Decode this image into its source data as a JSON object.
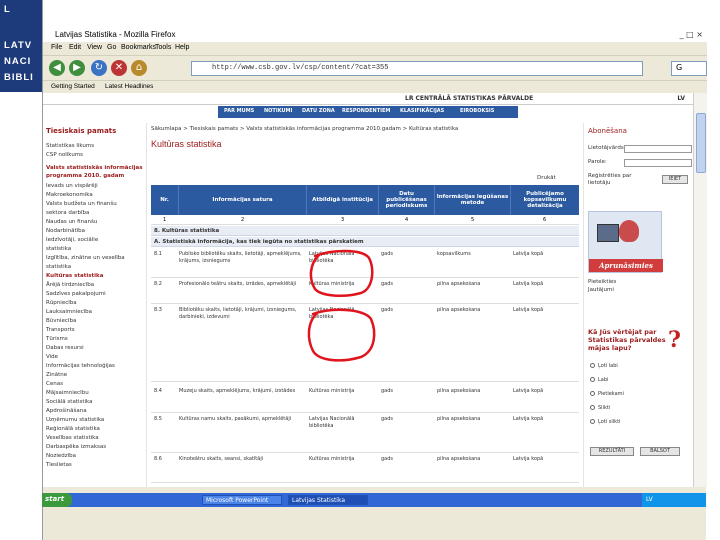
{
  "library_logo": [
    "L",
    "LATV",
    "NACI",
    "BIBLI"
  ],
  "window": {
    "title": "Latvijas Statistika - Mozilla Firefox",
    "controls": "_ □ ×"
  },
  "menu": [
    "File",
    "Edit",
    "View",
    "Go",
    "Bookmarks",
    "Tools",
    "Help"
  ],
  "address": {
    "url": "http://www.csb.gov.lv/csp/content/?cat=355",
    "search_value": "G"
  },
  "bookmarks": [
    "Getting Started",
    "Latest Headlines"
  ],
  "site": {
    "name": "LR CENTRĀLĀ STATISTIKAS PĀRVALDE",
    "lang": "LV",
    "nav": [
      "PAR MUMS",
      "NOTIKUMI",
      "DATU ZONA",
      "RESPONDENTIEM",
      "KLASIFIKĀCIJAS",
      "EIROBOKSIS"
    ]
  },
  "left": {
    "section": "Tiesiskais pamats",
    "links": [
      "Statistikas likums",
      "CSP nolikums"
    ],
    "highlight": [
      "Valsts statistiskās informācijas",
      "programma 2010. gadam"
    ],
    "items": [
      "Ievads un vispārēji",
      "Makroekonomika",
      "Valsts budžeta un finanšu",
      "sektora darbība",
      "Naudas un finanšu",
      "Nodarbinātība",
      "Iedzīvotāji, sociālie",
      "statistika",
      "Izglītība, zinātne un veselība",
      "statistika",
      "Kultūras statistika",
      "Ārējā tirdzniecība",
      "Sadzīves pakalpojumi",
      "Rūpniecība",
      "Lauksaimniecība",
      "Būvniecība",
      "Transports",
      "Tūrisms",
      "Dabas resursi",
      "Vide",
      "Informācijas tehnoloģijas",
      "Zinātne",
      "Cenas",
      "Mājsaimniecību",
      "Sociālā statistika",
      "Apdrošināšana",
      "Uzņēmumu statistika",
      "Reģionālā statistika",
      "Veselības statistika",
      "Darbaspēka izmaksas",
      "Noziedzība",
      "Tieslietas"
    ]
  },
  "main": {
    "breadcrumb": "Sākumlapa > Tiesiskais pamats > Valsts statistiskās informācijas programma 2010.gadam > Kultūras statistika",
    "title": "Kultūras statistika",
    "print": "Drukāt",
    "headers": [
      "Nr.",
      "Informācijas satura",
      "Atbildīgā institūcija",
      "Datu publicēšanas periodiskums",
      "Informācijas iegūšanas metode",
      "Publicējamo kopsavilkumu detalizācija"
    ],
    "col_numbers": [
      "1",
      "2",
      "3",
      "4",
      "5",
      "6"
    ],
    "section_a": "8. Kultūras statistika",
    "section_b": "A. Statistiskā informācija, kas tiek iegūta no statistikas pārskatiem",
    "rows_a": [
      {
        "nr": "8.1",
        "content": "Publisko bibliotēku skaits, lietotāji, apmeklējums, krājums, izsniegums",
        "inst": "Latvijas Nacionālā bibliotēka",
        "period": "gads",
        "method": "kopsavilkums",
        "detail": "Latvija kopā"
      },
      {
        "nr": "8.2",
        "content": "Profesionālo teātru skaits, izrādes, apmeklētāji",
        "inst": "Kultūras ministrija",
        "period": "gads",
        "method": "pilna apsekošana",
        "detail": "Latvija kopā"
      },
      {
        "nr": "8.3",
        "content": "Bibliotēku skaits, lietotāji, krājumi, izsniegums, darbinieki, izdevumi",
        "inst": "Latvijas Nacionālā bibliotēka",
        "period": "gads",
        "method": "pilna apsekošana",
        "detail": "Latvija kopā"
      }
    ],
    "rows_b": [
      {
        "nr": "8.4",
        "content": "Muzeju skaits, apmeklējums, krājumi, izstādes",
        "inst": "Kultūras ministrija",
        "period": "gads",
        "method": "pilna apsekošana",
        "detail": "Latvija kopā"
      },
      {
        "nr": "8.5",
        "content": "Kultūras namu skaits, pasākumi, apmeklētāji",
        "inst": "Latvijas Nacionālā bibliotēka",
        "period": "gads",
        "method": "pilna apsekošana",
        "detail": "Latvija kopā"
      },
      {
        "nr": "8.6",
        "content": "Kinoteātru skaits, seansi, skatītāji",
        "inst": "Kultūras ministrija",
        "period": "gads",
        "method": "pilna apsekošana",
        "detail": "Latvija kopā"
      }
    ]
  },
  "right": {
    "title": "Abonēšana",
    "user_label": "Lietotājvārds:",
    "pass_label": "Parole:",
    "note": "Reģistrēties par lietotāju",
    "login_button": "IEIET",
    "ad_text": "Aprunāsimies",
    "ad_links": [
      "Pieteikties",
      "Jautājumi"
    ],
    "poll_title": "Kā Jūs vērtējat par Statistikas pārvaldes mājas lapu?",
    "poll_options": [
      "Ļoti labi",
      "Labi",
      "Pietiekami",
      "Slikti",
      "Ļoti slikti"
    ],
    "vote_button": "REZULTĀTI",
    "results_button": "BALSOT"
  },
  "taskbar": {
    "start": "start",
    "tasks": [
      "Microsoft PowerPoint",
      "Latvijas Statistika"
    ],
    "tray": "LV"
  },
  "colors": {
    "accent": "#2b5aa0",
    "title_red": "#9b1b1b",
    "annotation": "#e0141c"
  }
}
